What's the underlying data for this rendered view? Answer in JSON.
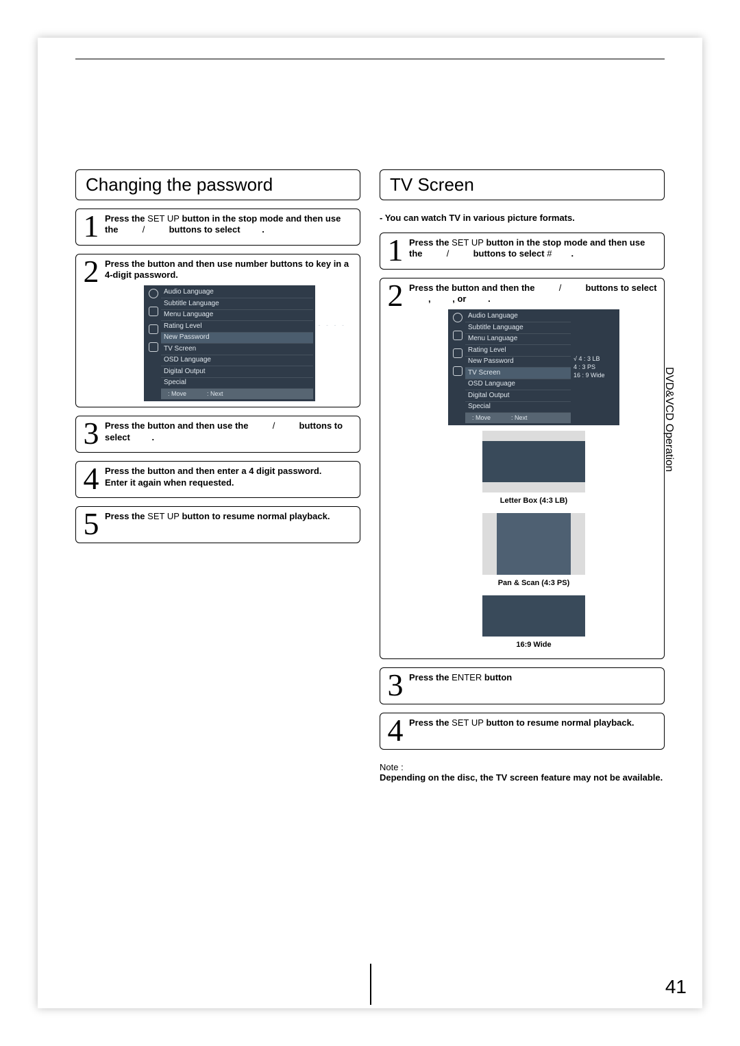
{
  "page_number": "41",
  "side_label": "DVD&VCD Operation",
  "left": {
    "heading": "Changing the password",
    "steps": {
      "s1_a": "Press the ",
      "s1_b": "SET UP",
      "s1_c": " button in the stop mode and then use the ",
      "s1_slash": " / ",
      "s1_e": " buttons to select ",
      "s1_f": ".",
      "s2": "Press the    button and then use number buttons to key in a 4-digit password.",
      "s3_a": "Press the    button and then use the ",
      "s3_slash": " / ",
      "s3_b": " buttons to select ",
      "s3_c": ".",
      "s4": "Press the    button and then enter a 4 digit password.\nEnter it again when requested.",
      "s5_a": "Press the ",
      "s5_b": "SET UP",
      "s5_c": " button to resume normal playback."
    },
    "osd": {
      "items": [
        "Audio Language",
        "Subtitle Language",
        "Menu Language",
        "Rating Level",
        "New Password",
        "TV Screen",
        "OSD Language",
        "Digital Output",
        "Special"
      ],
      "highlight": "New Password",
      "pw_dashes": "- - - -",
      "foot_move": ": Move",
      "foot_next": ": Next"
    }
  },
  "right": {
    "heading": "TV Screen",
    "intro": "- You can watch TV in various picture formats.",
    "steps": {
      "s1_a": "Press the ",
      "s1_b": "SET UP",
      "s1_c": " button in the stop mode and then use the ",
      "s1_slash": " / ",
      "s1_e": " buttons to select ",
      "s1_hash": "#",
      "s1_f": ".",
      "s2_a": "Press the    button and then the ",
      "s2_slash": " / ",
      "s2_b": " buttons to select ",
      "s2_c": ", ",
      "s2_d": ", or ",
      "s2_e": ".",
      "s3_a": "Press the ",
      "s3_b": "ENTER",
      "s3_c": " button",
      "s4_a": "Press the ",
      "s4_b": "SET UP",
      "s4_c": " button to resume normal playback."
    },
    "osd": {
      "items": [
        "Audio Language",
        "Subtitle Language",
        "Menu Language",
        "Rating Level",
        "New Password",
        "TV Screen",
        "OSD Language",
        "Digital Output",
        "Special"
      ],
      "highlight": "TV Screen",
      "side_sel": "4 : 3 LB",
      "side_opts": [
        "4 : 3 PS",
        "16 : 9 Wide"
      ],
      "foot_move": ": Move",
      "foot_next": ": Next"
    },
    "thumbs": {
      "lb": "Letter Box (4:3 LB)",
      "ps": "Pan & Scan (4:3 PS)",
      "wide": "16:9 Wide"
    },
    "note_label": "Note :",
    "note_body": "Depending on the disc, the TV screen feature may not be available."
  }
}
